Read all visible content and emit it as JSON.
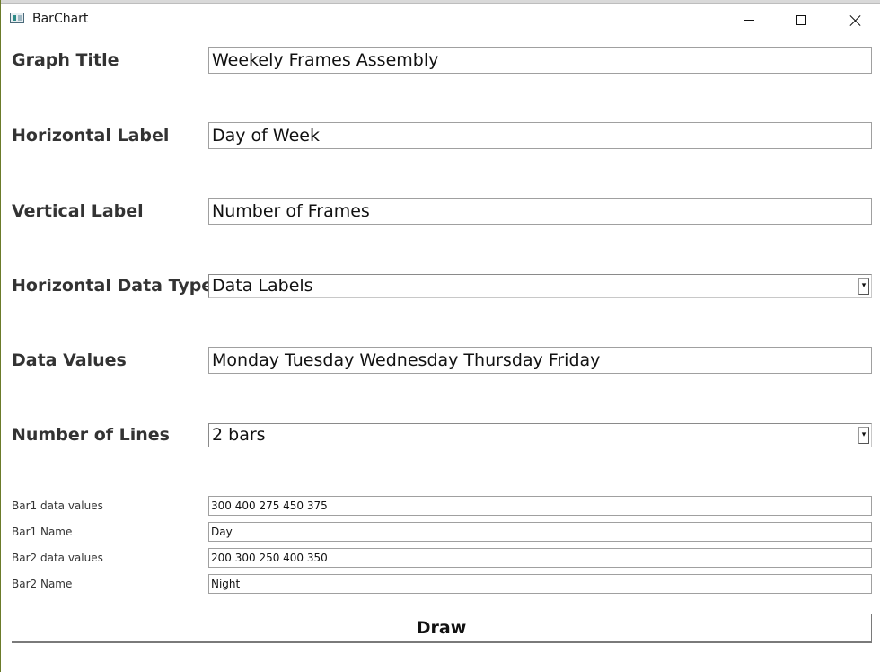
{
  "window": {
    "title": "BarChart",
    "icons": {
      "app": "bar-chart-app-icon",
      "minimize": "minimize-icon",
      "maximize": "maximize-icon",
      "close": "close-icon"
    }
  },
  "form": {
    "graph_title": {
      "label": "Graph Title",
      "value": "Weekely Frames Assembly"
    },
    "horizontal_label": {
      "label": "Horizontal Label",
      "value": "Day of Week"
    },
    "vertical_label": {
      "label": "Vertical Label",
      "value": "Number of Frames"
    },
    "horizontal_data_type": {
      "label": "Horizontal Data Type",
      "selected": "Data Labels"
    },
    "data_values": {
      "label": "Data Values",
      "value": "Monday Tuesday Wednesday Thursday Friday"
    },
    "number_of_lines": {
      "label": "Number of Lines",
      "selected": "2 bars"
    },
    "bars": [
      {
        "values_label": "Bar1 data values",
        "values": "300 400 275 450 375",
        "name_label": "Bar1 Name",
        "name": "Day"
      },
      {
        "values_label": "Bar2 data values",
        "values": "200 300 250 400 350",
        "name_label": "Bar2 Name",
        "name": "Night"
      }
    ]
  },
  "actions": {
    "draw_label": "Draw"
  }
}
